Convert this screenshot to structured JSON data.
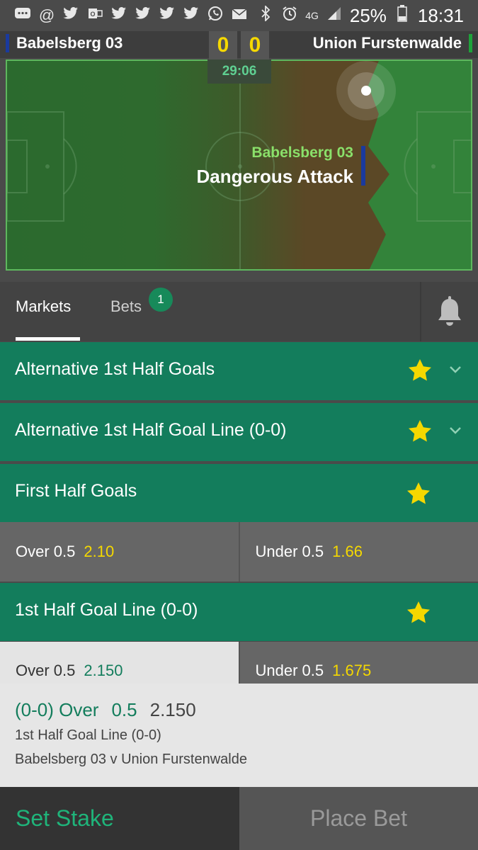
{
  "status_bar": {
    "battery_pct": "25%",
    "time": "18:31",
    "network": "4G",
    "icons": [
      "chat-icon",
      "at-icon",
      "twitter-icon",
      "outlook-icon",
      "twitter-icon",
      "twitter-icon",
      "twitter-icon",
      "twitter-icon",
      "whatsapp-icon",
      "mail-icon",
      "bluetooth-icon",
      "alarm-icon",
      "signal-icon",
      "battery-icon"
    ]
  },
  "match": {
    "home_team": "Babelsberg 03",
    "away_team": "Union Furstenwalde",
    "home_score": "0",
    "away_score": "0",
    "clock": "29:06",
    "event_team": "Babelsberg 03",
    "event_text": "Dangerous Attack"
  },
  "tabs": {
    "markets": "Markets",
    "bets": "Bets",
    "bets_count": "1"
  },
  "markets": [
    {
      "title": "Alternative 1st Half Goals"
    },
    {
      "title": "Alternative 1st Half Goal Line (0-0)"
    },
    {
      "title": "First Half Goals",
      "odds": [
        {
          "label": "Over 0.5",
          "price": "2.10"
        },
        {
          "label": "Under 0.5",
          "price": "1.66"
        }
      ]
    },
    {
      "title": "1st Half Goal Line (0-0)",
      "odds": [
        {
          "label": "Over 0.5",
          "price": "2.150"
        },
        {
          "label": "Under 0.5",
          "price": "1.675"
        }
      ]
    }
  ],
  "betslip": {
    "selection": "(0-0) Over",
    "handicap": "0.5",
    "price": "2.150",
    "market": "1st Half Goal Line (0-0)",
    "event": "Babelsberg 03 v Union Furstenwalde"
  },
  "buttons": {
    "set_stake": "Set Stake",
    "place_bet": "Place Bet"
  },
  "colors": {
    "brand_green": "#137d5c",
    "odds_yellow": "#f5d800",
    "home_team_color": "#1a3a9e",
    "away_team_color": "#1fa23a"
  }
}
